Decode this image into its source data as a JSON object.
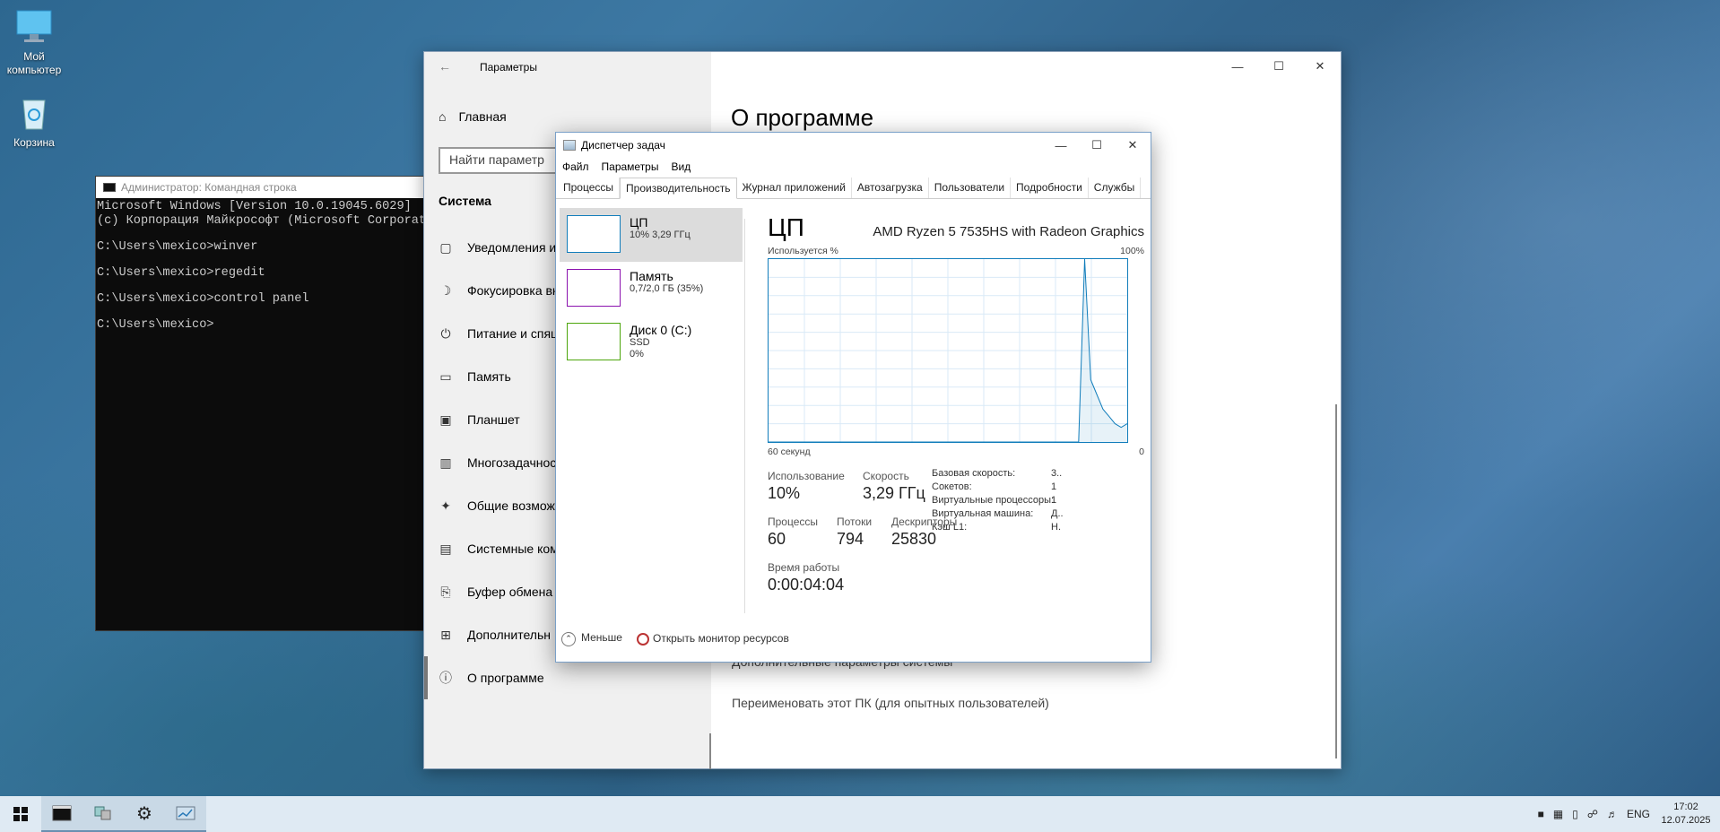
{
  "desktop": {
    "icons": [
      {
        "label": "Мой компьютер"
      },
      {
        "label": "Корзина"
      }
    ]
  },
  "cmd": {
    "title": "Администратор: Командная строка",
    "lines": [
      "Microsoft Windows [Version 10.0.19045.6029]",
      "(c) Корпорация Майкрософт (Microsoft Corporati",
      "",
      "C:\\Users\\mexico>winver",
      "",
      "C:\\Users\\mexico>regedit",
      "",
      "C:\\Users\\mexico>control panel",
      "",
      "C:\\Users\\mexico>"
    ]
  },
  "settings": {
    "title": "Параметры",
    "home": "Главная",
    "search_placeholder": "Найти параметр",
    "section": "Система",
    "nav": [
      {
        "label": "Уведомления и",
        "icon": "notification-icon"
      },
      {
        "label": "Фокусировка вн",
        "icon": "moon-icon"
      },
      {
        "label": "Питание и спящ",
        "icon": "power-icon"
      },
      {
        "label": "Память",
        "icon": "storage-icon"
      },
      {
        "label": "Планшет",
        "icon": "tablet-icon"
      },
      {
        "label": "Многозадачност",
        "icon": "multitasking-icon"
      },
      {
        "label": "Общие возмож",
        "icon": "shared-icon"
      },
      {
        "label": "Системные ком",
        "icon": "components-icon"
      },
      {
        "label": "Буфер обмена",
        "icon": "clipboard-icon"
      },
      {
        "label": "Дополнительн",
        "icon": "more-icon"
      },
      {
        "label": "О программе",
        "icon": "info-icon"
      }
    ],
    "main_title": "О программе",
    "link_advanced": "Дополнительные параметры системы",
    "link_rename": "Переименовать этот ПК (для опытных пользователей)"
  },
  "taskmgr": {
    "title": "Диспетчер задач",
    "menu": [
      "Файл",
      "Параметры",
      "Вид"
    ],
    "tabs": [
      "Процессы",
      "Производительность",
      "Журнал приложений",
      "Автозагрузка",
      "Пользователи",
      "Подробности",
      "Службы"
    ],
    "active_tab": 1,
    "resources": [
      {
        "name": "ЦП",
        "sub1": "10% 3,29 ГГц",
        "sub2": "",
        "color": "#117dbb"
      },
      {
        "name": "Память",
        "sub1": "0,7/2,0 ГБ (35%)",
        "sub2": "",
        "color": "#8b12ae"
      },
      {
        "name": "Диск 0 (C:)",
        "sub1": "SSD",
        "sub2": "0%",
        "color": "#4da60c"
      }
    ],
    "cpu": {
      "heading": "ЦП",
      "model": "AMD Ryzen 5 7535HS with Radeon Graphics",
      "graph_label_left": "Используется %",
      "graph_label_right": "100%",
      "axis_left": "60 секунд",
      "axis_right": "0",
      "usage_label": "Использование",
      "usage_value": "10%",
      "speed_label": "Скорость",
      "speed_value": "3,29 ГГц",
      "proc_label": "Процессы",
      "proc_value": "60",
      "threads_label": "Потоки",
      "threads_value": "794",
      "handles_label": "Дескрипторы",
      "handles_value": "25830",
      "uptime_label": "Время работы",
      "uptime_value": "0:00:04:04",
      "details": [
        {
          "k": "Базовая скорость:",
          "v": "3.."
        },
        {
          "k": "Сокетов:",
          "v": "1"
        },
        {
          "k": "Виртуальные процессоры:",
          "v": "1"
        },
        {
          "k": "Виртуальная машина:",
          "v": "Д.."
        },
        {
          "k": "Кэш L1:",
          "v": "Н."
        }
      ],
      "history": [
        0,
        0,
        0,
        0,
        0,
        0,
        0,
        0,
        0,
        0,
        0,
        0,
        0,
        0,
        0,
        0,
        0,
        0,
        0,
        0,
        0,
        0,
        0,
        0,
        0,
        0,
        0,
        0,
        0,
        0,
        0,
        0,
        0,
        0,
        0,
        0,
        0,
        0,
        0,
        0,
        0,
        0,
        0,
        0,
        0,
        0,
        0,
        0,
        0,
        0,
        0,
        0,
        100,
        34,
        26,
        18,
        14,
        10,
        8,
        10
      ]
    },
    "footer_less": "Меньше",
    "footer_monitor": "Открыть монитор ресурсов"
  },
  "taskbar": {
    "lang": "ENG",
    "time": "17:02",
    "date": "12.07.2025"
  }
}
